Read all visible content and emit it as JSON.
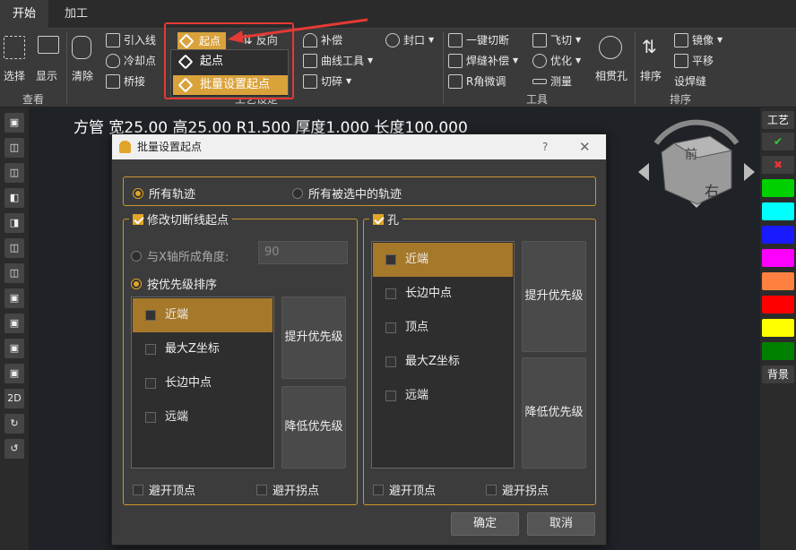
{
  "tabs": [
    "开始",
    "加工"
  ],
  "ribbon": {
    "view": {
      "select": "选择",
      "display": "显示",
      "group": "查看"
    },
    "craft": {
      "clear": "清除",
      "lead_in": "引入线",
      "cooling": "冷却点",
      "bridge": "桥接",
      "start": "起点",
      "reverse": "反向",
      "compensate": "补偿",
      "curve_tool": "曲线工具",
      "shatter": "切碎",
      "seal": "封口",
      "group": "工艺设定"
    },
    "tools": {
      "one_key_cut": "一键切断",
      "weld_comp": "焊缝补偿",
      "r_fine": "R角微调",
      "fly_cut": "飞切",
      "optimize": "优化",
      "measure": "测量",
      "through_hole": "相贯孔",
      "group": "工具"
    },
    "sort": {
      "sort": "排序",
      "mirror": "镜像",
      "translate": "平移",
      "set_weld": "设焊缝",
      "group": "排序"
    },
    "dropdown": [
      "起点",
      "批量设置起点"
    ]
  },
  "left_toolbar": [
    "2D"
  ],
  "info_line": "方管 宽25.00 高25.00 R1.500 厚度1.000 长度100.000",
  "right_toolbar": {
    "craft": "工艺",
    "background": "背景",
    "colors": [
      "#00d000",
      "#00ffff",
      "#1a1aff",
      "#ff00ff",
      "#ff8040",
      "#ff0000",
      "#ffff00",
      "#008000"
    ]
  },
  "cube": {
    "top": "前",
    "right": "右"
  },
  "dialog": {
    "title": "批量设置起点",
    "help": "?",
    "close": "✕",
    "scope": {
      "all": "所有轨迹",
      "selected": "所有被选中的轨迹"
    },
    "cut_section": {
      "title": "修改切断线起点",
      "angle_label": "与X轴所成角度:",
      "angle_value": "90",
      "priority_label": "按优先级排序",
      "items": [
        "近端",
        "最大Z坐标",
        "长边中点",
        "远端"
      ],
      "up": "提升优先级",
      "down": "降低优先级",
      "avoid_vertex": "避开顶点",
      "avoid_corner": "避开拐点"
    },
    "hole_section": {
      "title": "孔",
      "items": [
        "近端",
        "长边中点",
        "顶点",
        "最大Z坐标",
        "远端"
      ],
      "up": "提升优先级",
      "down": "降低优先级",
      "avoid_vertex": "避开顶点",
      "avoid_corner": "避开拐点"
    },
    "ok": "确定",
    "cancel": "取消"
  }
}
